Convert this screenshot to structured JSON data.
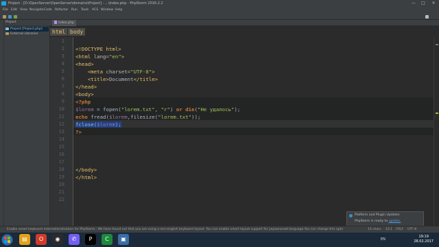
{
  "window": {
    "title": "Project - [D:\\OpenServer\\OpenServer\\domains\\Project] - ...\\index.php - PhpStorm 2016.2.2",
    "controls": {
      "minimize": "—",
      "maximize": "□",
      "close": "✕"
    }
  },
  "menu": [
    "File",
    "Edit",
    "View",
    "Navigate",
    "Code",
    "Refactor",
    "Run",
    "Tools",
    "VCS",
    "Window",
    "Help"
  ],
  "project_panel": {
    "header": "Project",
    "items": [
      "Project [Project.php]",
      "External Libraries"
    ]
  },
  "editor": {
    "tab": "index.php",
    "breadcrumbs": [
      "html",
      "body"
    ],
    "line_numbers": [
      "1",
      "2",
      "3",
      "4",
      "5",
      "6",
      "7",
      "8",
      "9",
      "10",
      "11",
      "12",
      "13",
      "14",
      "15",
      "16",
      "17",
      "18",
      "19",
      "20",
      "21",
      "22"
    ],
    "lines": [
      [],
      [
        {
          "t": "<!DOCTYPE html>",
          "c": "tag"
        }
      ],
      [
        {
          "t": "<html ",
          "c": "tag"
        },
        {
          "t": "lang",
          "c": "attr"
        },
        {
          "t": "=",
          "c": "txt"
        },
        {
          "t": "\"en\"",
          "c": "str"
        },
        {
          "t": ">",
          "c": "tag"
        }
      ],
      [
        {
          "t": "<head>",
          "c": "tag"
        }
      ],
      [
        {
          "t": "    ",
          "c": "txt"
        },
        {
          "t": "<meta ",
          "c": "tag"
        },
        {
          "t": "charset",
          "c": "attr"
        },
        {
          "t": "=",
          "c": "txt"
        },
        {
          "t": "\"UTF-8\"",
          "c": "str"
        },
        {
          "t": ">",
          "c": "tag"
        }
      ],
      [
        {
          "t": "    ",
          "c": "txt"
        },
        {
          "t": "<title>",
          "c": "tag"
        },
        {
          "t": "Document",
          "c": "txt"
        },
        {
          "t": "</title>",
          "c": "tag"
        }
      ],
      [
        {
          "t": "</head>",
          "c": "tag"
        }
      ],
      [
        {
          "t": "<body>",
          "c": "tag"
        }
      ],
      [
        {
          "t": "<?php",
          "c": "kw"
        }
      ],
      [
        {
          "t": "$lorem",
          "c": "var"
        },
        {
          "t": " = fopen(",
          "c": "txt"
        },
        {
          "t": "\"lorem.txt\"",
          "c": "str"
        },
        {
          "t": ", ",
          "c": "txt"
        },
        {
          "t": "\"r\"",
          "c": "str"
        },
        {
          "t": ") ",
          "c": "txt"
        },
        {
          "t": "or die",
          "c": "kw"
        },
        {
          "t": "(",
          "c": "txt"
        },
        {
          "t": "\"Не удалось\"",
          "c": "str"
        },
        {
          "t": ");",
          "c": "txt"
        }
      ],
      [
        {
          "t": "echo",
          "c": "kw"
        },
        {
          "t": " fread(",
          "c": "txt"
        },
        {
          "t": "$lorem",
          "c": "var"
        },
        {
          "t": ",filesize(",
          "c": "txt"
        },
        {
          "t": "\"lorem.txt\"",
          "c": "str"
        },
        {
          "t": "));",
          "c": "txt"
        }
      ],
      [
        {
          "t": "fclose(",
          "c": "txt",
          "sel": true
        },
        {
          "t": "$lorem",
          "c": "var",
          "sel": true
        },
        {
          "t": ");",
          "c": "txt",
          "sel": true
        }
      ],
      [
        {
          "t": "?>",
          "c": "kw"
        }
      ],
      [],
      [],
      [],
      [],
      [
        {
          "t": "</body>",
          "c": "tag"
        }
      ],
      [
        {
          "t": "</html>",
          "c": "tag"
        }
      ],
      [],
      [],
      []
    ]
  },
  "statusbar": {
    "message": "Enable smart keyboard internationalization for PhpStorm.: We have found out that you are using a non-english keyboard layout. You can enable smart layout support for украинский language.You can change this option in the set... (20 minutes ago)",
    "items": [
      "15 chars",
      "12:1",
      "CRLF",
      "UTF-8"
    ]
  },
  "notification": {
    "title": "Platform and Plugin Updates",
    "body": "PhpStorm is ready to",
    "link": "update."
  },
  "taskbar": {
    "tray": "EN",
    "time": "19:19",
    "date": "28.02.2017"
  },
  "colors": {
    "background": "#2b2b2b",
    "tag": "#e8bf6a",
    "string": "#a5c25c",
    "keyword": "#cc7832",
    "variable": "#9876aa",
    "selection": "#214283"
  }
}
